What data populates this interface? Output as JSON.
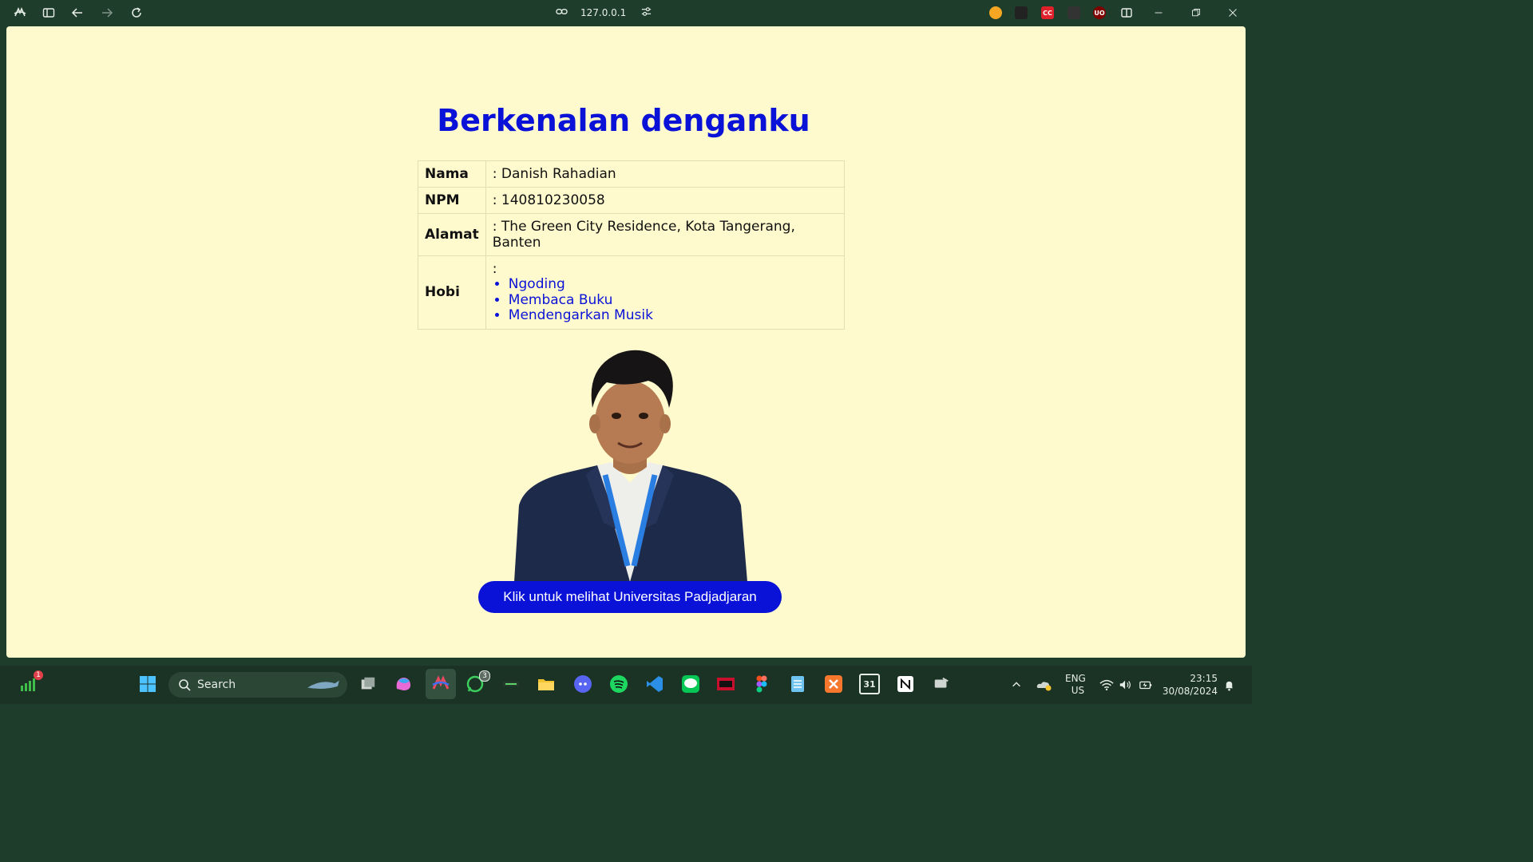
{
  "browser": {
    "url": "127.0.0.1",
    "extensions": [
      {
        "name": "clock-extension-icon",
        "label": "",
        "color": "#f5a623"
      },
      {
        "name": "gamepad-extension-icon",
        "label": "",
        "color": "#222222"
      },
      {
        "name": "cc-extension-icon",
        "label": "CC",
        "color": "#e0202a"
      },
      {
        "name": "terminal-extension-icon",
        "label": "",
        "color": "#333333"
      },
      {
        "name": "ublock-extension-icon",
        "label": "UO",
        "color": "#800000"
      }
    ]
  },
  "page": {
    "title": "Berkenalan denganku",
    "rows": [
      {
        "key": "Nama",
        "value": ": Danish Rahadian"
      },
      {
        "key": "NPM",
        "value": ": 140810230058"
      },
      {
        "key": "Alamat",
        "value": ": The Green City Residence, Kota Tangerang, Banten"
      }
    ],
    "hobi": {
      "key": "Hobi",
      "prefix": ":",
      "items": [
        "Ngoding",
        "Membaca Buku",
        "Mendengarkan Musik"
      ]
    },
    "cta_label": "Klik untuk melihat Universitas Padjadjaran",
    "colors": {
      "background": "#fffacd",
      "accent": "#0a12d8"
    }
  },
  "taskbar": {
    "search_label": "Search",
    "notification_count": "1",
    "whatsapp_badge": "3",
    "language_primary": "ENG",
    "language_secondary": "US",
    "time": "23:15",
    "date": "30/08/2024",
    "calendar_day": "31",
    "apps": [
      "task-view",
      "copilot",
      "arc-browser",
      "whatsapp",
      "terminal",
      "file-explorer",
      "discord",
      "spotify",
      "vscode",
      "line",
      "mongodb-compass",
      "figma",
      "notepad",
      "xampp",
      "calendar",
      "notion",
      "screen-share"
    ]
  }
}
